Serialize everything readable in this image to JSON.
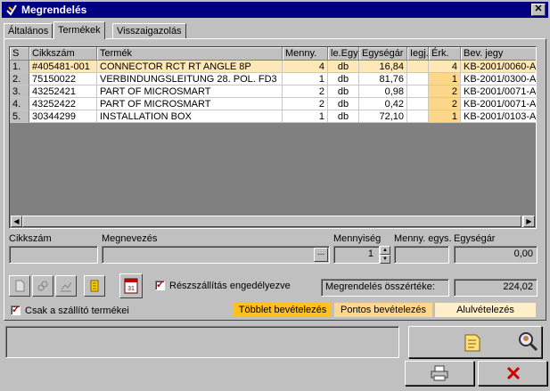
{
  "window": {
    "title": "Megrendelés"
  },
  "tabs": [
    "Általános",
    "Termékek",
    "Visszaigazolás"
  ],
  "grid": {
    "columns": [
      "S",
      "Cikkszám",
      "Termék",
      "Menny.",
      "le.Egy",
      "Egységár",
      "Iegj.",
      "Érk.",
      "Bev. jegy"
    ],
    "rows": [
      [
        "1.",
        "#405481-001",
        "CONNECTOR RCT RT ANGLE 8P",
        "4",
        "db",
        "16,84",
        "",
        "4",
        "KB-2001/0060-A"
      ],
      [
        "2.",
        "75150022",
        "VERBINDUNGSLEITUNG 28. POL. FD3",
        "1",
        "db",
        "81,76",
        "",
        "1",
        "KB-2001/0300-A"
      ],
      [
        "3.",
        "43252421",
        "PART OF MICROSMART",
        "2",
        "db",
        "0,98",
        "",
        "2",
        "KB-2001/0071-A"
      ],
      [
        "4.",
        "43252422",
        "PART OF MICROSMART",
        "2",
        "db",
        "0,42",
        "",
        "2",
        "KB-2001/0071-A"
      ],
      [
        "5.",
        "30344299",
        "INSTALLATION BOX",
        "1",
        "db",
        "72,10",
        "",
        "1",
        "KB-2001/0103-A"
      ]
    ]
  },
  "editor": {
    "labels": {
      "code": "Cikkszám",
      "name": "Megnevezés",
      "qty": "Mennyiség",
      "unit": "Menny. egys.",
      "price": "Egységár"
    },
    "values": {
      "code": "",
      "name": "",
      "qty": "1",
      "unit": "",
      "price": "0,00"
    },
    "ellipsis": "..."
  },
  "options": {
    "partial_delivery": "Részszállítás engedélyezve",
    "supplier_only": "Csak a szállító termékei"
  },
  "total": {
    "label": "Megrendelés összértéke:",
    "value": "224,02"
  },
  "legend": {
    "surplus": "Többlet bevételezés",
    "exact": "Pontos bevételezés",
    "under": "Alulvételezés"
  },
  "colors": {
    "title_bar": "#000080",
    "surplus": "#ffc020",
    "exact": "#ffd890",
    "under": "#ffefc8",
    "selected_row": "#ffe8b8",
    "close_red": "#d00000"
  },
  "icons": {
    "toolbar": [
      "new-doc-icon",
      "link-icon",
      "chart-icon",
      "note-icon",
      "calendar-icon"
    ],
    "actions": [
      "document-list-icon",
      "search-person-icon",
      "print-icon",
      "cancel-icon"
    ]
  }
}
